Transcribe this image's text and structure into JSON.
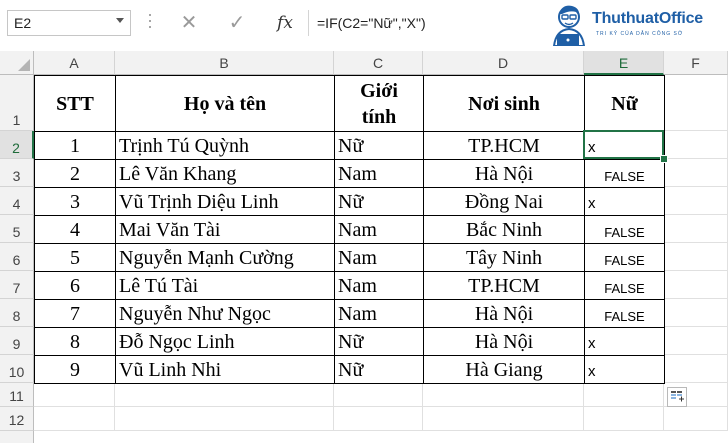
{
  "name_box": "E2",
  "formula": "=IF(C2=\"Nữ\",\"X\")",
  "logo": {
    "brand": "ThuthuatOffice",
    "tagline": "TRI KỶ CỦA DÂN CÔNG SỞ"
  },
  "columns": [
    "A",
    "B",
    "C",
    "D",
    "E",
    "F"
  ],
  "rows": [
    "1",
    "2",
    "3",
    "4",
    "5",
    "6",
    "7",
    "8",
    "9",
    "10",
    "11",
    "12"
  ],
  "headers": {
    "stt": "STT",
    "name": "Họ và tên",
    "gender_l1": "Giới",
    "gender_l2": "tính",
    "birthplace": "Nơi sinh",
    "female": "Nữ"
  },
  "table": [
    {
      "stt": "1",
      "name": "Trịnh Tú Quỳnh",
      "gender": "Nữ",
      "place": "TP.HCM",
      "result": "x"
    },
    {
      "stt": "2",
      "name": "Lê Văn Khang",
      "gender": "Nam",
      "place": "Hà Nội",
      "result": "FALSE"
    },
    {
      "stt": "3",
      "name": "Vũ Trịnh Diệu Linh",
      "gender": "Nữ",
      "place": "Đồng Nai",
      "result": "x"
    },
    {
      "stt": "4",
      "name": "Mai Văn Tài",
      "gender": "Nam",
      "place": "Bắc Ninh",
      "result": "FALSE"
    },
    {
      "stt": "5",
      "name": "Nguyễn Mạnh Cường",
      "gender": "Nam",
      "place": "Tây Ninh",
      "result": "FALSE"
    },
    {
      "stt": "6",
      "name": "Lê Tú Tài",
      "gender": "Nam",
      "place": "TP.HCM",
      "result": "FALSE"
    },
    {
      "stt": "7",
      "name": "Nguyễn Như Ngọc",
      "gender": "Nam",
      "place": "Hà Nội",
      "result": "FALSE"
    },
    {
      "stt": "8",
      "name": "Đỗ Ngọc Linh",
      "gender": "Nữ",
      "place": "Hà Nội",
      "result": "x"
    },
    {
      "stt": "9",
      "name": "Vũ Linh Nhi",
      "gender": "Nữ",
      "place": "Hà Giang",
      "result": "x"
    }
  ],
  "icons": {
    "cancel": "close-icon",
    "confirm": "check-icon",
    "function": "fx-icon",
    "quick_analysis": "quick-analysis-icon"
  },
  "colors": {
    "accent": "#217346",
    "logo": "#1f5fa6"
  }
}
